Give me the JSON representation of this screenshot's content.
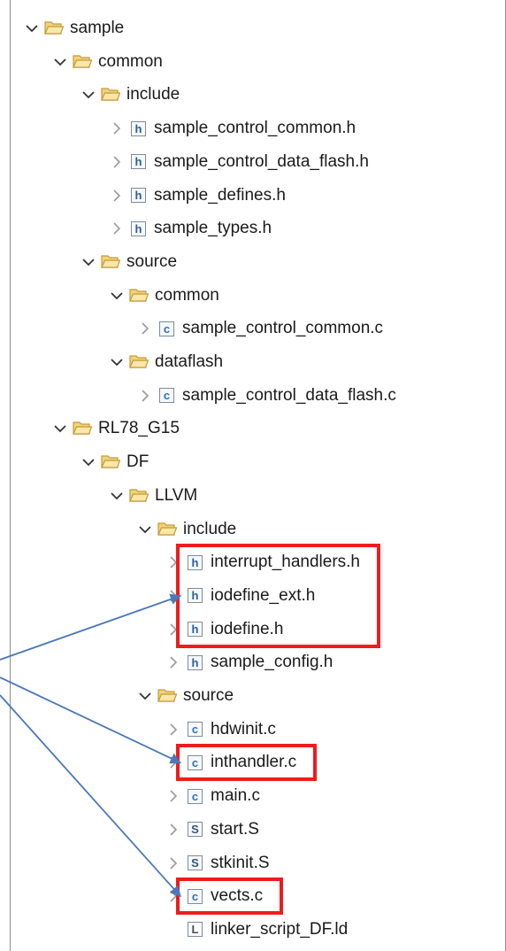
{
  "tree": [
    {
      "label": "sample",
      "type": "folder",
      "expanded": true
    },
    {
      "label": "common",
      "type": "folder",
      "expanded": true
    },
    {
      "label": "include",
      "type": "folder",
      "expanded": true
    },
    {
      "label": "sample_control_common.h",
      "type": "h",
      "expanded": false
    },
    {
      "label": "sample_control_data_flash.h",
      "type": "h",
      "expanded": false
    },
    {
      "label": "sample_defines.h",
      "type": "h",
      "expanded": false
    },
    {
      "label": "sample_types.h",
      "type": "h",
      "expanded": false
    },
    {
      "label": "source",
      "type": "folder",
      "expanded": true
    },
    {
      "label": "common",
      "type": "folder",
      "expanded": true
    },
    {
      "label": "sample_control_common.c",
      "type": "c",
      "expanded": false
    },
    {
      "label": "dataflash",
      "type": "folder",
      "expanded": true
    },
    {
      "label": "sample_control_data_flash.c",
      "type": "c",
      "expanded": false
    },
    {
      "label": "RL78_G15",
      "type": "folder",
      "expanded": true
    },
    {
      "label": "DF",
      "type": "folder",
      "expanded": true
    },
    {
      "label": "LLVM",
      "type": "folder",
      "expanded": true
    },
    {
      "label": "include",
      "type": "folder",
      "expanded": true
    },
    {
      "label": "interrupt_handlers.h",
      "type": "h",
      "expanded": false,
      "highlighted": true
    },
    {
      "label": "iodefine_ext.h",
      "type": "h",
      "expanded": false,
      "highlighted": true
    },
    {
      "label": "iodefine.h",
      "type": "h",
      "expanded": false,
      "highlighted": true
    },
    {
      "label": "sample_config.h",
      "type": "h",
      "expanded": false
    },
    {
      "label": "source",
      "type": "folder",
      "expanded": true
    },
    {
      "label": "hdwinit.c",
      "type": "c",
      "expanded": false
    },
    {
      "label": "inthandler.c",
      "type": "c",
      "expanded": false,
      "highlighted": true
    },
    {
      "label": "main.c",
      "type": "c",
      "expanded": false
    },
    {
      "label": "start.S",
      "type": "s",
      "expanded": false
    },
    {
      "label": "stkinit.S",
      "type": "s",
      "expanded": false
    },
    {
      "label": "vects.c",
      "type": "c",
      "expanded": false,
      "highlighted": true
    },
    {
      "label": "linker_script_DF.ld",
      "type": "l",
      "expanded": null
    }
  ],
  "icon_letters": {
    "h": "h",
    "c": "c",
    "s": "S",
    "l": "L"
  },
  "colors": {
    "highlight_box": "#ee1c1c",
    "arrow": "#4a78b8",
    "folder_fill": "#f3d27a",
    "folder_stroke": "#c39a3a"
  }
}
